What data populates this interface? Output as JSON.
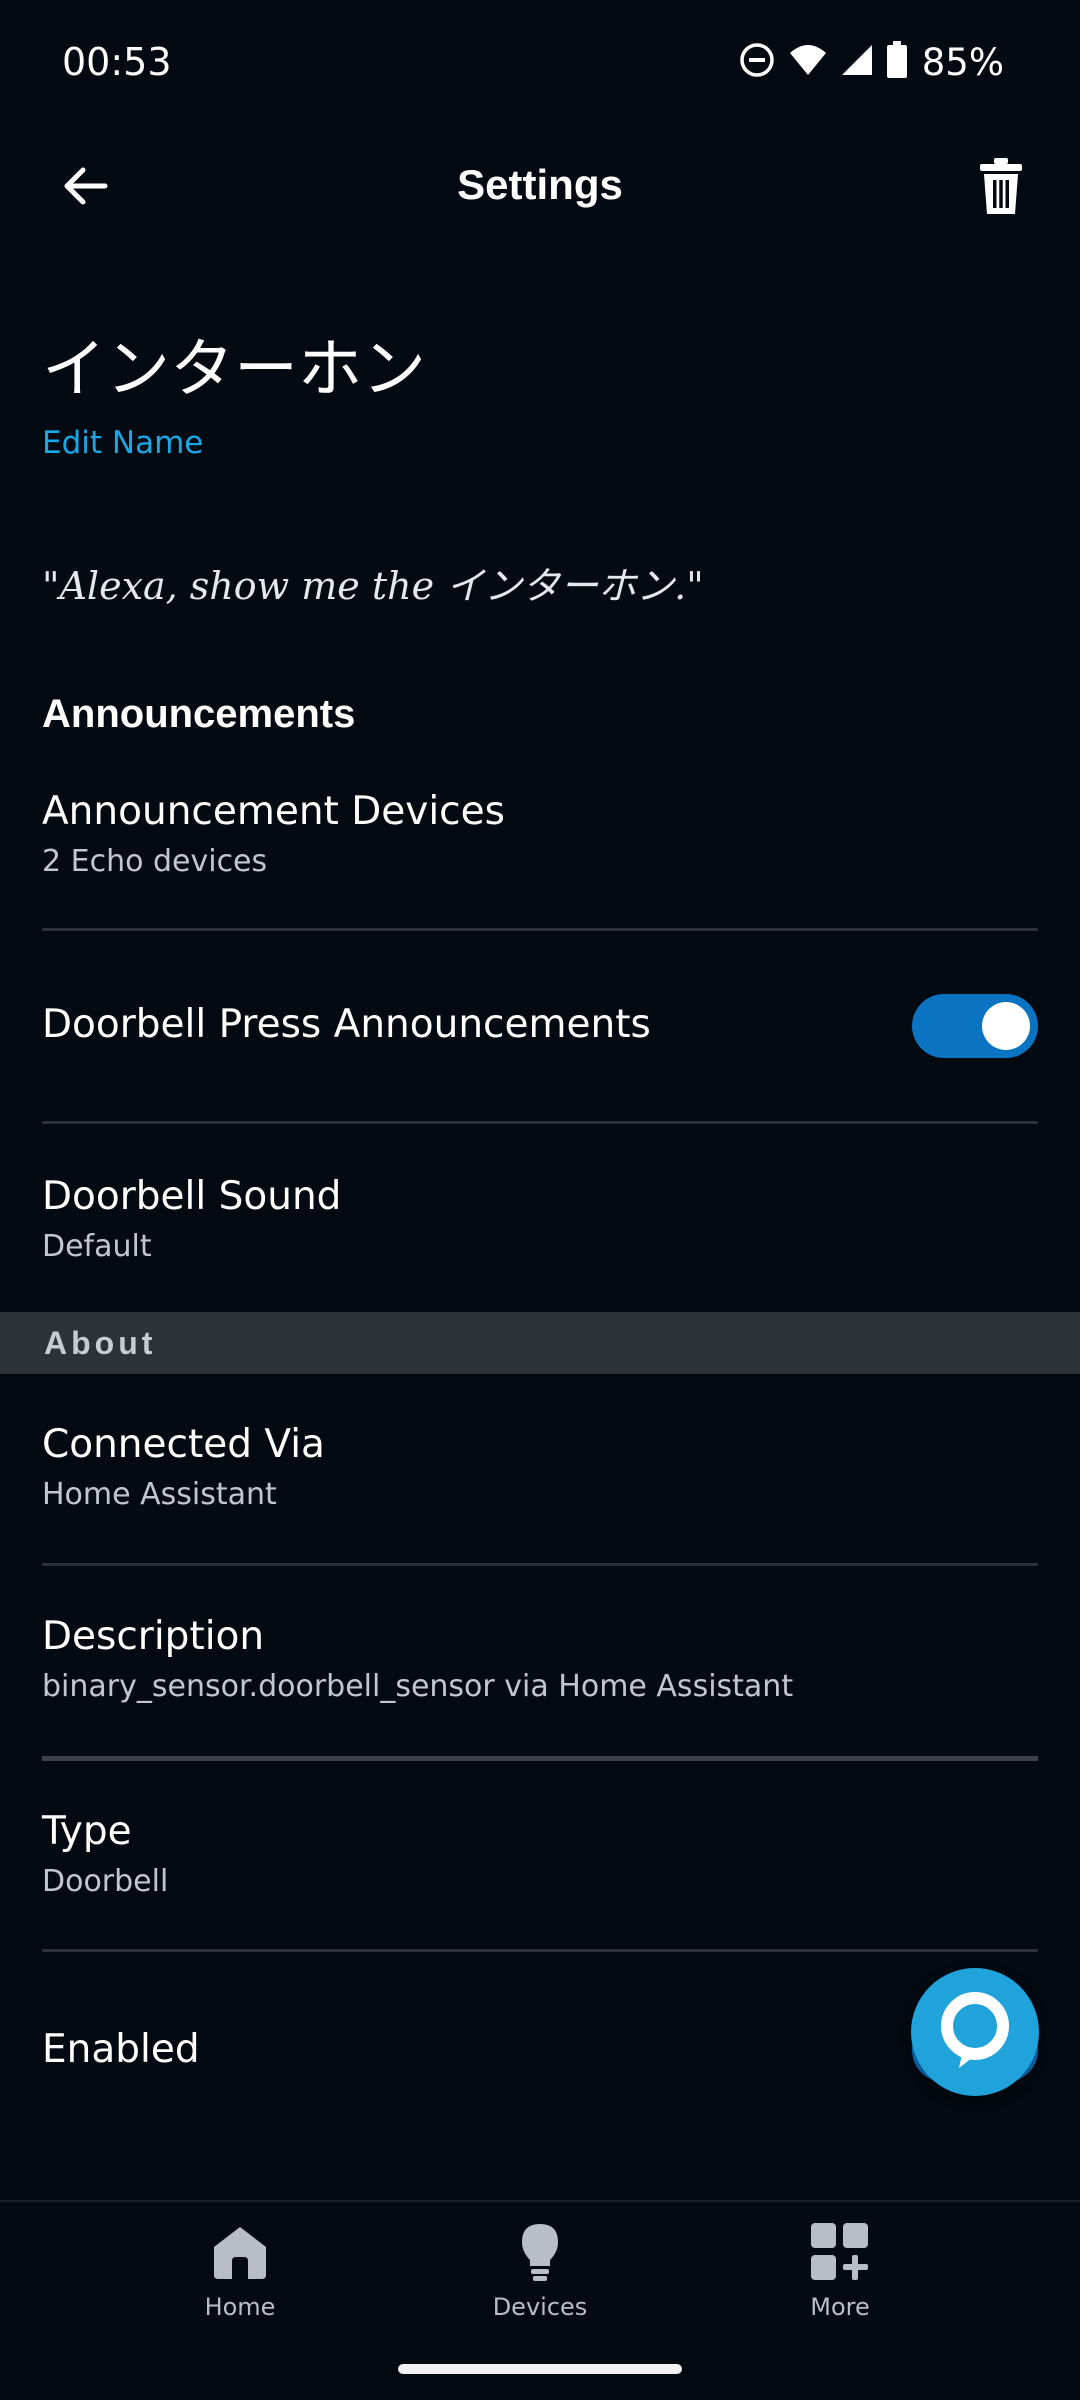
{
  "status_bar": {
    "time": "00:53",
    "battery": "85%",
    "icons": [
      "do-not-disturb-icon",
      "wifi-icon",
      "signal-icon",
      "battery-icon"
    ]
  },
  "header": {
    "title": "Settings",
    "back_icon": "arrow-left-icon",
    "delete_icon": "trash-icon"
  },
  "device": {
    "name": "インターホン",
    "edit_name": "Edit Name",
    "voice_hint": "\"Alexa, show me the インターホン.\""
  },
  "announcements": {
    "heading": "Announcements",
    "devices_title": "Announcement Devices",
    "devices_value": "2 Echo devices",
    "press_title": "Doorbell Press Announcements",
    "press_enabled": true,
    "sound_title": "Doorbell Sound",
    "sound_value": "Default"
  },
  "about": {
    "heading": "About",
    "connected_title": "Connected Via",
    "connected_value": "Home Assistant",
    "description_title": "Description",
    "description_value": "binary_sensor.doorbell_sensor via Home Assistant",
    "type_title": "Type",
    "type_value": "Doorbell",
    "enabled_title": "Enabled",
    "enabled": true
  },
  "bottom_nav": {
    "items": [
      {
        "label": "Home",
        "icon": "home-icon"
      },
      {
        "label": "Devices",
        "icon": "lightbulb-icon"
      },
      {
        "label": "More",
        "icon": "grid-plus-icon"
      }
    ]
  },
  "colors": {
    "background": "#040a12",
    "accent_link": "#1aa7e8",
    "toggle_on": "#0a74c2",
    "alexa_blue": "#1fa3da",
    "about_band": "#2d3239"
  }
}
